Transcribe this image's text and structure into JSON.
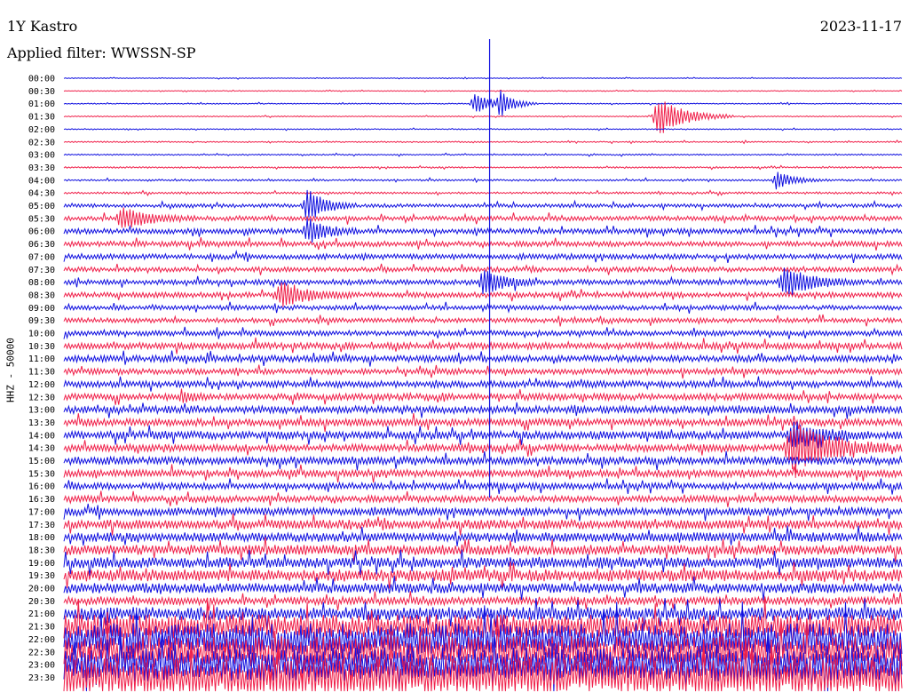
{
  "header": {
    "station": "1Y Kastro",
    "date": "2023-11-17",
    "filter": "Applied filter: WWSSN-SP"
  },
  "chart_data": {
    "type": "line",
    "title": "1Y Kastro",
    "subtitle": "Applied filter: WWSSN-SP",
    "date": "2023-11-17",
    "ylabel": "HHZ - 50000",
    "xlabel": "",
    "row_interval_minutes": 30,
    "row_labels": [
      "00:00",
      "00:30",
      "01:00",
      "01:30",
      "02:00",
      "02:30",
      "03:00",
      "03:30",
      "04:00",
      "04:30",
      "05:00",
      "05:30",
      "06:00",
      "06:30",
      "07:00",
      "07:30",
      "08:00",
      "08:30",
      "09:00",
      "09:30",
      "10:00",
      "10:30",
      "11:00",
      "11:30",
      "12:00",
      "12:30",
      "13:00",
      "13:30",
      "14:00",
      "14:30",
      "15:00",
      "15:30",
      "16:00",
      "16:30",
      "17:00",
      "17:30",
      "18:00",
      "18:30",
      "19:00",
      "19:30",
      "20:00",
      "20:30",
      "21:00",
      "21:30",
      "22:00",
      "22:30",
      "23:00",
      "23:30"
    ],
    "series": [
      {
        "name": "",
        "color": "#1010e0",
        "rows": "even"
      },
      {
        "name": "",
        "color": "#f0204a",
        "rows": "odd"
      }
    ],
    "noise_level": [
      0.3,
      0.3,
      0.4,
      0.4,
      0.4,
      0.5,
      0.5,
      0.6,
      0.7,
      0.8,
      1.4,
      1.8,
      2.0,
      2.0,
      2.0,
      1.8,
      2.0,
      2.0,
      1.8,
      1.8,
      2.0,
      2.5,
      2.5,
      2.2,
      2.5,
      2.5,
      2.8,
      2.8,
      3.0,
      2.8,
      3.0,
      2.8,
      2.5,
      2.5,
      3.0,
      3.5,
      3.5,
      3.8,
      4.0,
      4.5,
      3.8,
      3.0,
      5.0,
      9.0,
      12.0,
      12.0,
      13.0,
      14.0
    ],
    "events": [
      {
        "row": 2,
        "x": 0.49,
        "amp": 12,
        "width": 0.02
      },
      {
        "row": 2,
        "x": 0.52,
        "amp": 14,
        "width": 0.015
      },
      {
        "row": 3,
        "x": 0.71,
        "amp": 22,
        "width": 0.03
      },
      {
        "row": 11,
        "x": 0.07,
        "amp": 12,
        "width": 0.03
      },
      {
        "row": 10,
        "x": 0.29,
        "amp": 20,
        "width": 0.02
      },
      {
        "row": 12,
        "x": 0.29,
        "amp": 15,
        "width": 0.02
      },
      {
        "row": 16,
        "x": 0.5,
        "amp": 18,
        "width": 0.02
      },
      {
        "row": 16,
        "x": 0.86,
        "amp": 16,
        "width": 0.03
      },
      {
        "row": 17,
        "x": 0.26,
        "amp": 14,
        "width": 0.03
      },
      {
        "row": 8,
        "x": 0.85,
        "amp": 10,
        "width": 0.02
      },
      {
        "row": 25,
        "x": 0.14,
        "amp": 8,
        "width": 0.01
      },
      {
        "row": 29,
        "x": 0.87,
        "amp": 30,
        "width": 0.04
      },
      {
        "row": 28,
        "x": 0.87,
        "amp": 14,
        "width": 0.03
      }
    ],
    "vertical_spike_x": 0.508,
    "vertical_spike_top": 44
  }
}
